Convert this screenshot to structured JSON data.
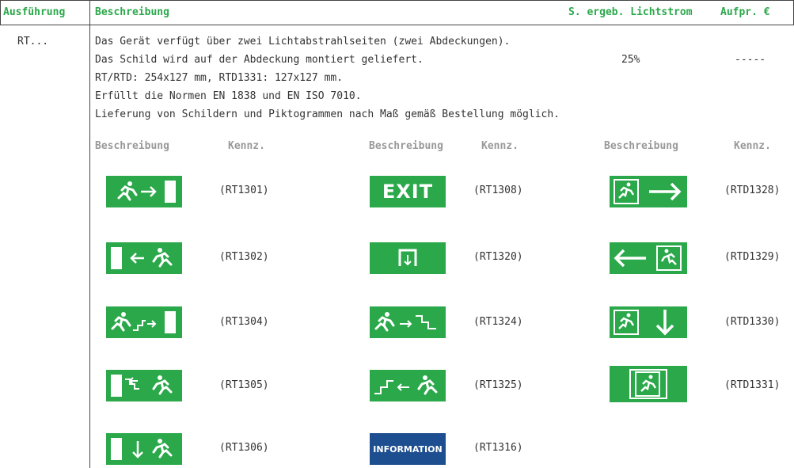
{
  "header": {
    "ausfuehrung": "Ausführung",
    "beschreibung": "Beschreibung",
    "lichtstrom": "S. ergeb. Lichtstrom",
    "aufpreis": "Aufpr. €"
  },
  "row": {
    "ausfuehrung": "RT...",
    "lines": [
      "Das Gerät verfügt über zwei Lichtabstrahlseiten (zwei Abdeckungen).",
      "Das Schild wird auf der Abdeckung montiert geliefert.",
      "RT/RTD: 254x127 mm, RTD1331: 127x127 mm.",
      "Erfüllt die Normen EN 1838 und EN ISO 7010.",
      "Lieferung von Schildern und Piktogrammen nach Maß gemäß Bestellung möglich."
    ],
    "lichtstrom": "25%",
    "aufpreis": "-----"
  },
  "table_headers": {
    "beschreibung": "Beschreibung",
    "kennz": "Kennz."
  },
  "signs": {
    "col1": [
      "(RT1301)",
      "(RT1302)",
      "(RT1304)",
      "(RT1305)",
      "(RT1306)"
    ],
    "col2": [
      "(RT1308)",
      "(RT1320)",
      "(RT1324)",
      "(RT1325)",
      "(RT1316)"
    ],
    "col3": [
      "(RTD1328)",
      "(RTD1329)",
      "(RTD1330)",
      "(RTD1331)"
    ],
    "exit_text": "EXIT",
    "information_text": "INFORMATION"
  },
  "colors": {
    "accent": "#2aa84a",
    "info_blue": "#1d4e8f",
    "rule": "#444444",
    "muted": "#999999"
  }
}
